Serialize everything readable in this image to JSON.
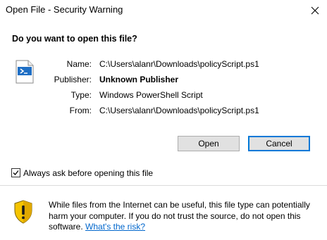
{
  "window": {
    "title": "Open File - Security Warning",
    "close_icon": "close-icon"
  },
  "question": "Do you want to open this file?",
  "file_icon": "powershell-script-file-icon",
  "details": [
    {
      "label": "Name:",
      "value": "C:\\Users\\alanr\\Downloads\\policyScript.ps1",
      "bold": false
    },
    {
      "label": "Publisher:",
      "value": "Unknown Publisher",
      "bold": true
    },
    {
      "label": "Type:",
      "value": "Windows PowerShell Script",
      "bold": false
    },
    {
      "label": "From:",
      "value": "C:\\Users\\alanr\\Downloads\\policyScript.ps1",
      "bold": false
    }
  ],
  "buttons": {
    "open_label": "Open",
    "cancel_label": "Cancel"
  },
  "checkbox": {
    "label": "Always ask before opening this file",
    "checked": true
  },
  "warning": {
    "icon": "shield-warning-icon",
    "text": "While files from the Internet can be useful, this file type can potentially harm your computer. If you do not trust the source, do not open this software.",
    "link_text": "What's the risk?"
  },
  "colors": {
    "accent": "#0078d7",
    "link": "#0066cc",
    "button_bg": "#e1e1e1",
    "shield_yellow": "#f5c400"
  }
}
